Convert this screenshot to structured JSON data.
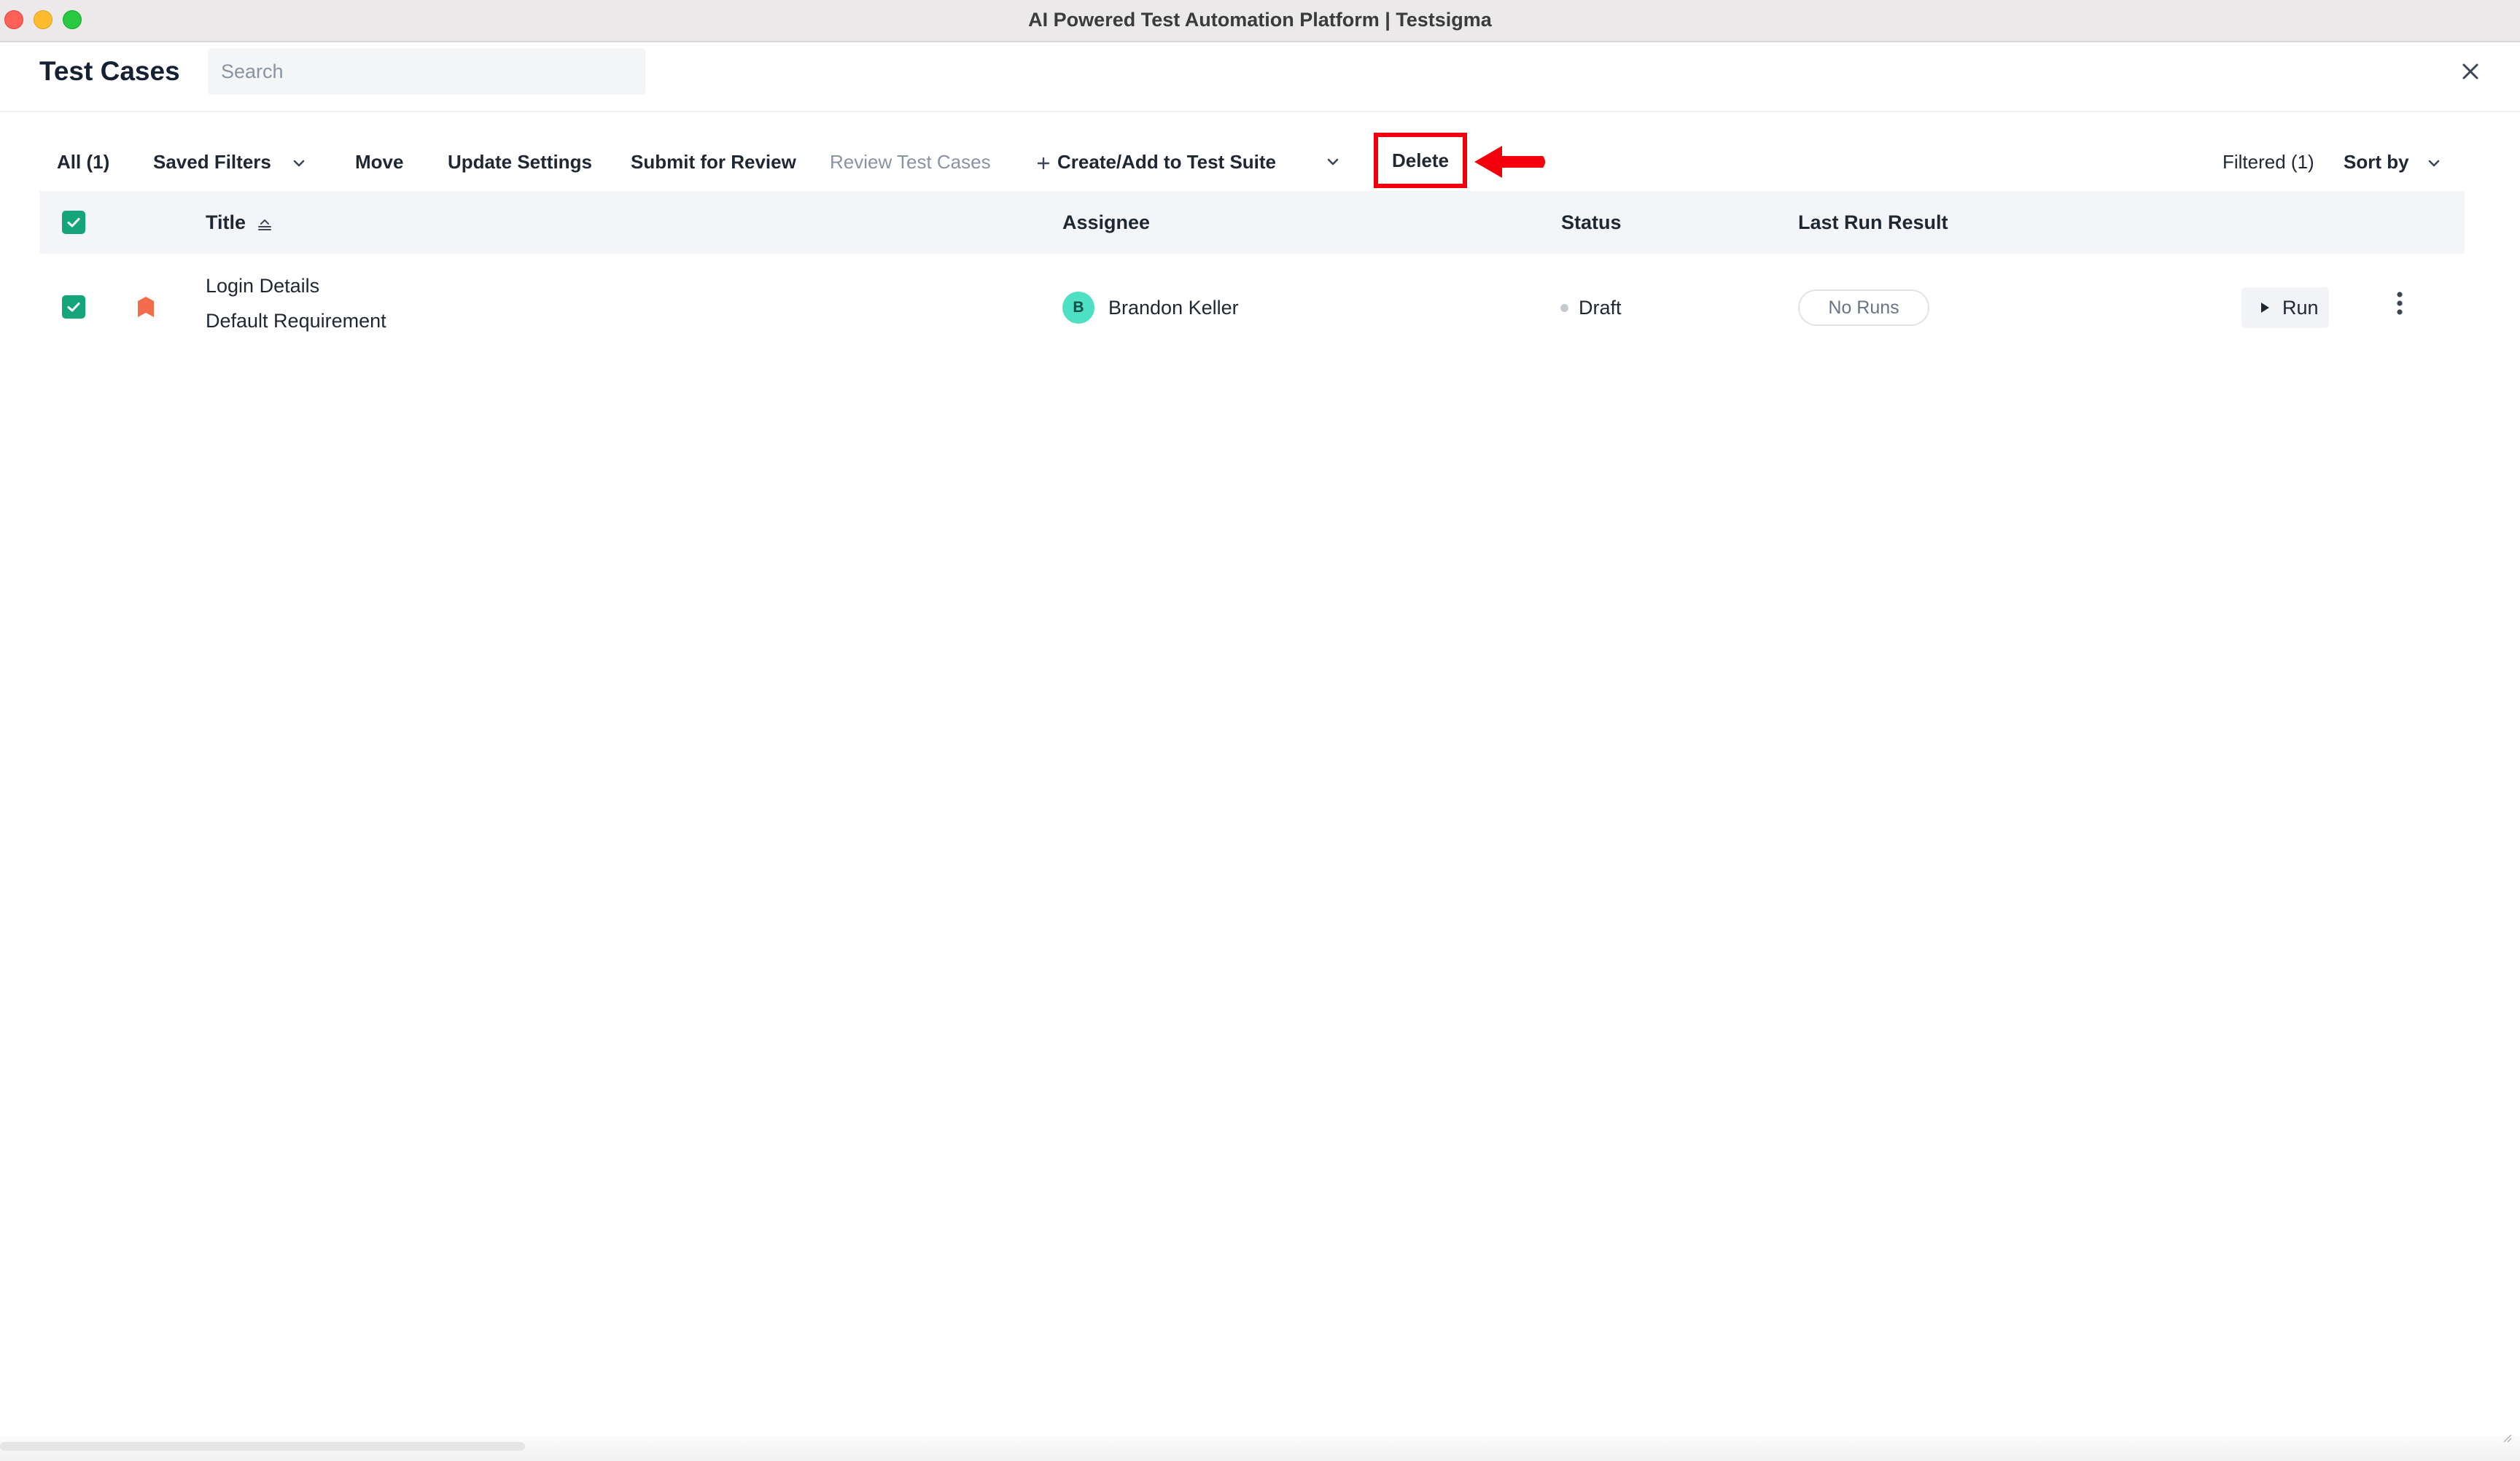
{
  "window": {
    "title": "AI Powered Test Automation Platform | Testsigma"
  },
  "header": {
    "title": "Test Cases",
    "search_placeholder": "Search"
  },
  "toolbar": {
    "all": "All (1)",
    "saved_filters": "Saved Filters",
    "move": "Move",
    "update_settings": "Update Settings",
    "submit_for_review": "Submit for Review",
    "review_test_cases": "Review Test Cases",
    "create_add_suite": "Create/Add to Test Suite",
    "delete": "Delete",
    "filtered": "Filtered (1)",
    "sort_by": "Sort by"
  },
  "table": {
    "columns": {
      "title": "Title",
      "assignee": "Assignee",
      "status": "Status",
      "last_run_result": "Last Run Result"
    },
    "rows": [
      {
        "checked": true,
        "title": "Login Details",
        "requirement": "Default Requirement",
        "assignee_initial": "B",
        "assignee": "Brandon Keller",
        "status": "Draft",
        "last_run": "No Runs",
        "run_label": "Run"
      }
    ]
  },
  "annotation": {
    "color": "#f2000c",
    "target": "delete-button"
  },
  "colors": {
    "accent_green": "#14a67a",
    "priority_orange": "#f26b4a",
    "avatar": "#4de0c2"
  }
}
